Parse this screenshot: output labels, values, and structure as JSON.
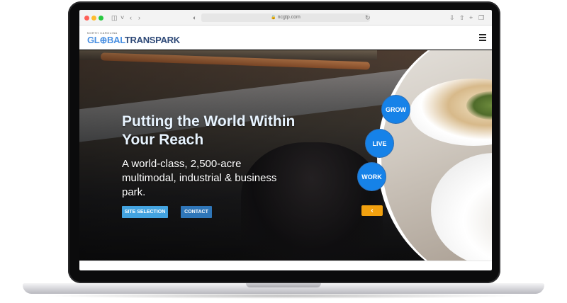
{
  "browser": {
    "url": "ncgtp.com"
  },
  "site": {
    "logo_top": "NORTH CAROLINA",
    "logo_glo": "GL⊕BAL",
    "logo_trans": "TRANSPARK"
  },
  "hero": {
    "title": "Putting the World Within Your Reach",
    "subtitle": "A world-class, 2,500-acre multimodal, industrial & business park.",
    "site_selection_label": "SITE SELECTION",
    "contact_label": "CONTACT",
    "grow_label": "GROW",
    "live_label": "LIVE",
    "work_label": "WORK",
    "prev_arrow": "‹"
  },
  "colors": {
    "accent_blue": "#1682e8",
    "button_blue": "#43a3e0",
    "contact_blue": "#2f76b8",
    "arrow_orange": "#f2a10f"
  }
}
